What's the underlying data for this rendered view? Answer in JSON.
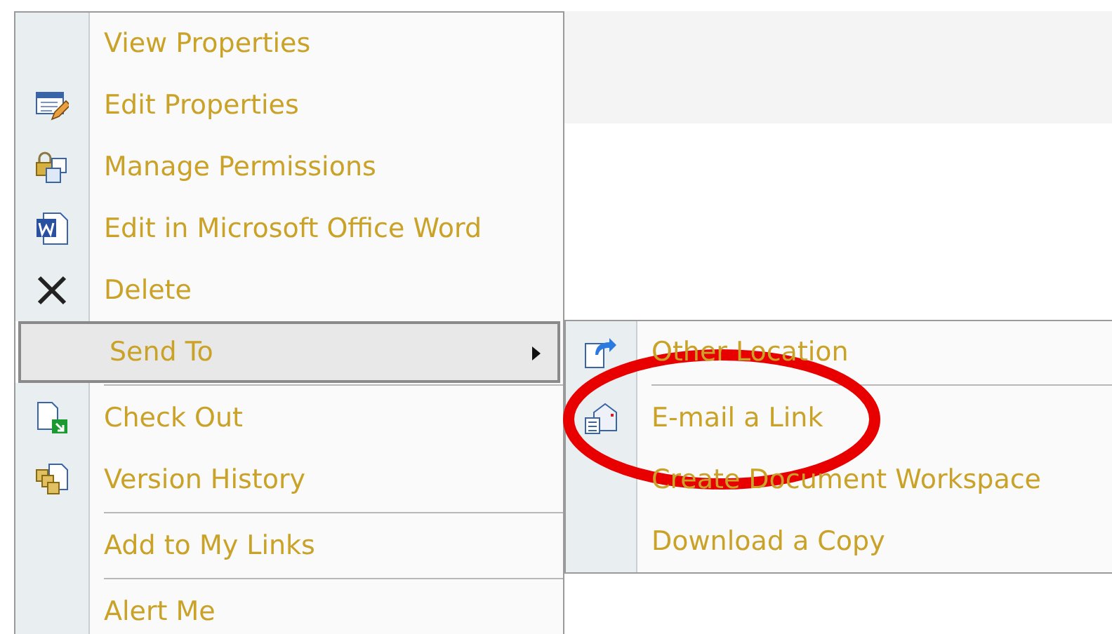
{
  "context_menu": {
    "items": [
      {
        "kind": "item",
        "label": "View Properties",
        "selected": false
      },
      {
        "kind": "item",
        "label": "Edit Properties",
        "selected": false
      },
      {
        "kind": "item",
        "label": "Manage Permissions",
        "selected": false
      },
      {
        "kind": "item",
        "label": "Edit in Microsoft Office Word",
        "selected": false
      },
      {
        "kind": "item",
        "label": "Delete",
        "selected": false
      },
      {
        "kind": "submenu",
        "label": "Send To",
        "selected": true
      },
      {
        "kind": "separator"
      },
      {
        "kind": "item",
        "label": "Check Out",
        "selected": false
      },
      {
        "kind": "item",
        "label": "Version History",
        "selected": false
      },
      {
        "kind": "separator"
      },
      {
        "kind": "item",
        "label": "Add to My Links",
        "selected": false
      },
      {
        "kind": "separator"
      },
      {
        "kind": "item",
        "label": "Alert Me",
        "selected": false
      }
    ]
  },
  "send_to_submenu": {
    "items": [
      {
        "kind": "item",
        "label": "Other Location",
        "selected": false
      },
      {
        "kind": "separator"
      },
      {
        "kind": "item",
        "label": "E-mail a Link",
        "selected": false
      },
      {
        "kind": "item",
        "label": "Create Document Workspace",
        "selected": false
      },
      {
        "kind": "item",
        "label": "Download a Copy",
        "selected": false
      }
    ]
  }
}
